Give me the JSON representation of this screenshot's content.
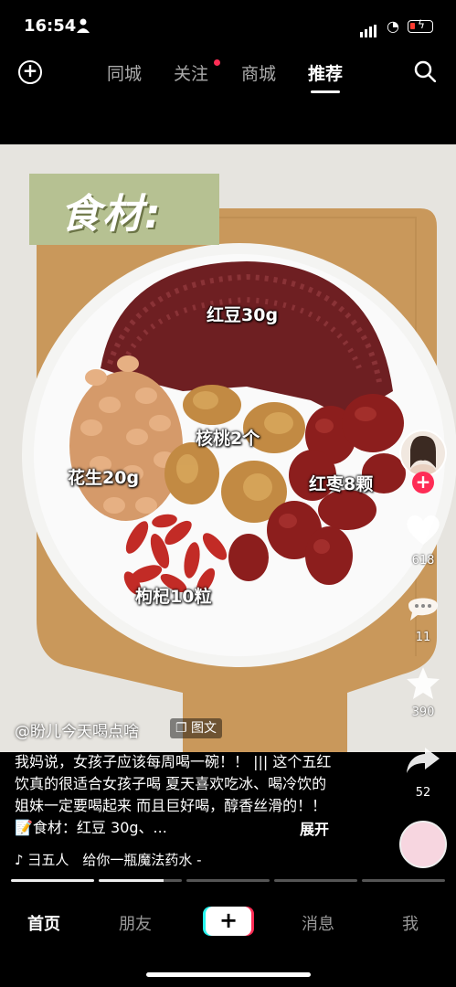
{
  "status_bar": {
    "time": "16:54"
  },
  "top_nav": {
    "tabs": [
      {
        "label": "同城"
      },
      {
        "label": "关注"
      },
      {
        "label": "商城"
      },
      {
        "label": "推荐"
      }
    ],
    "active_tab": "推荐"
  },
  "post": {
    "overlay_title": "食材:",
    "ingredient_labels": {
      "red_bean": "红豆30g",
      "walnut": "核桃2个",
      "peanut": "花生20g",
      "jujube": "红枣8颗",
      "goji": "枸杞10粒"
    },
    "author": "@盼儿今天喝点啥",
    "type_tag": "图文",
    "caption": "我妈说，女孩子应该每周喝一碗！！ ||| 这个五红饮真的很适合女孩子喝 夏天喜欢吃冰、喝冷饮的姐妹一定要喝起来 而且巨好喝，醇香丝滑的！！ 📝食材：红豆 30g、...",
    "expand_label": "展开",
    "music": "♪ 彐五人　给你一瓶魔法药水 -"
  },
  "actions": {
    "likes": "618",
    "comments": "11",
    "favorites": "390",
    "shares": "52"
  },
  "bottom_nav": {
    "items": [
      "首页",
      "朋友",
      "+",
      "消息",
      "我"
    ]
  },
  "colors": {
    "accent": "#fe2c55",
    "title_box": "#b6c192",
    "red_bean": "#6e1f22"
  }
}
